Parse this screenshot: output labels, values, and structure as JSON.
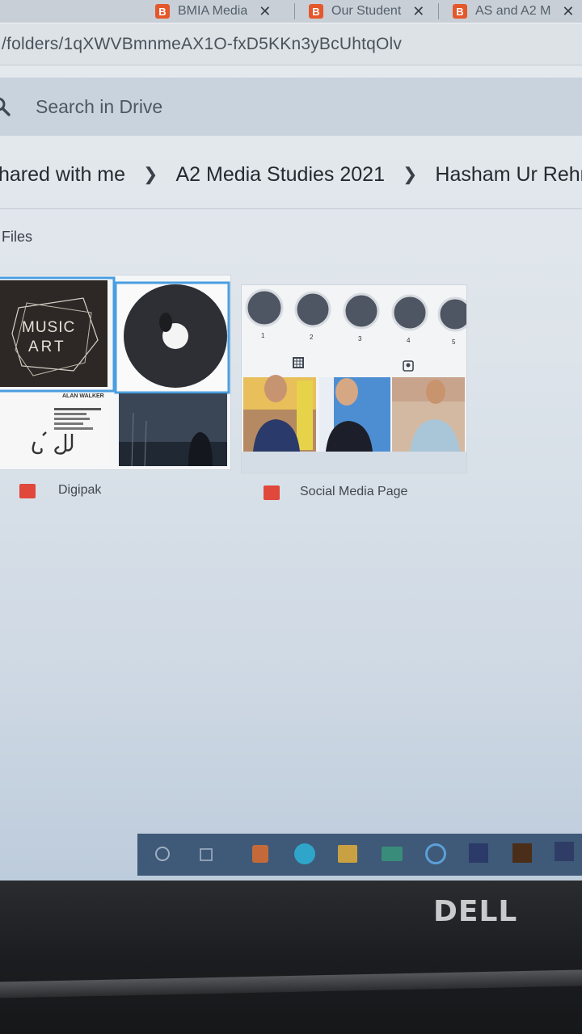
{
  "browser": {
    "tabs": [
      {
        "label": "BMIA Media",
        "close": "✕"
      },
      {
        "label": "Our Student",
        "close": "✕"
      },
      {
        "label": "AS and A2 M",
        "close": "✕"
      }
    ],
    "url": "/folders/1qXWVBmnmeAX1O-fxD5KKn3yBcUhtqOlv"
  },
  "drive": {
    "search_placeholder": "Search in Drive",
    "breadcrumb": [
      "hared with me",
      "A2 Media Studies 2021",
      "Hasham Ur Rehman"
    ],
    "section_label": "Files",
    "files": [
      {
        "name": "Digipak",
        "type": "image"
      },
      {
        "name": "Social Media Page",
        "type": "image"
      }
    ]
  },
  "thumbnails": {
    "digipak_logo_line1": "MUSIC",
    "digipak_logo_line2": "ART",
    "digipak_artist": "ALAN WALKER",
    "social_highlights": [
      "1",
      "2",
      "3",
      "4",
      "5"
    ]
  },
  "hardware": {
    "brand": "DELL"
  },
  "colors": {
    "file_icon": "#e0483b",
    "taskbar": "#3f5978"
  }
}
